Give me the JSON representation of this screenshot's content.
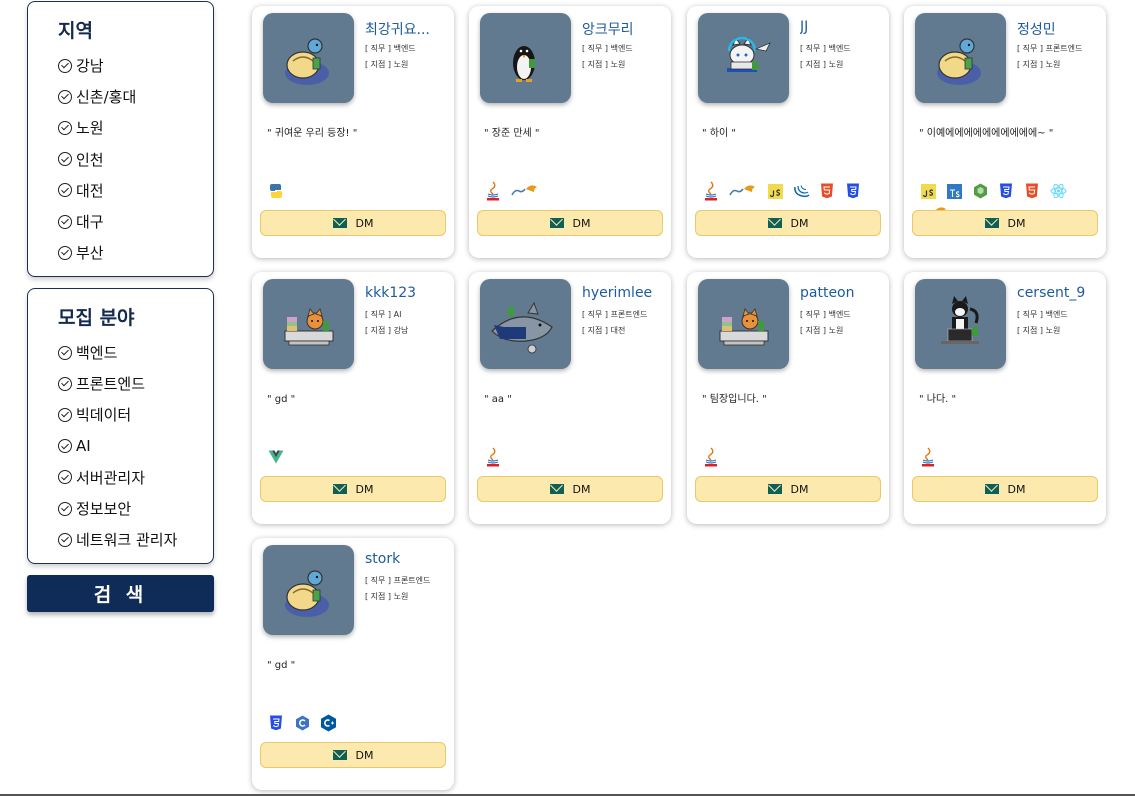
{
  "filters": {
    "region": {
      "title": "지역",
      "items": [
        "강남",
        "신촌/홍대",
        "노원",
        "인천",
        "대전",
        "대구",
        "부산"
      ]
    },
    "field": {
      "title": "모집 분야",
      "items": [
        "백엔드",
        "프론트엔드",
        "빅데이터",
        "AI",
        "서버관리자",
        "정보보안",
        "네트워크 관리자"
      ]
    },
    "search_label": "검 색"
  },
  "dm_label": "DM",
  "cards": [
    {
      "name": "최강귀요...",
      "job": "[ 직무 ] 백엔드",
      "branch": "[ 지점 ] 노원",
      "intro": "\" 귀여운 우리 등장! \"",
      "avatar": "turtle-avatar",
      "skills": [
        "python-icon"
      ]
    },
    {
      "name": "앙크무리",
      "job": "[ 직무 ] 백엔드",
      "branch": "[ 지점 ] 노원",
      "intro": "\" 장준 만세 \"",
      "avatar": "penguin-avatar",
      "skills": [
        "java-icon",
        "mysql-icon"
      ]
    },
    {
      "name": "JJ",
      "job": "[ 직무 ] 백엔드",
      "branch": "[ 지점 ] 노원",
      "intro": "\" 하이 \"",
      "avatar": "cat-laptop-avatar",
      "skills": [
        "java-icon",
        "mysql-icon",
        "javascript-icon",
        "jquery-icon",
        "html5-icon",
        "css3-icon"
      ]
    },
    {
      "name": "정성민",
      "job": "[ 직무 ] 프론트엔드",
      "branch": "[ 지점 ] 노원",
      "intro": "\" 이예에에에에에에에에에에~ \"",
      "avatar": "turtle-avatar",
      "skills": [
        "javascript-icon",
        "typescript-icon",
        "nodejs-icon",
        "css3-icon",
        "html5-icon",
        "react-icon",
        "mysql-icon"
      ]
    },
    {
      "name": "kkk123",
      "job": "[ 직무 ] AI",
      "branch": "[ 지점 ] 강남",
      "intro": "\" gd \"",
      "avatar": "cat-desk-avatar",
      "skills": [
        "vue-icon"
      ]
    },
    {
      "name": "hyerimlee",
      "job": "[ 직무 ] 프론트엔드",
      "branch": "[ 지점 ] 대전",
      "intro": "\" aa \"",
      "avatar": "shark-avatar",
      "skills": [
        "java-icon"
      ]
    },
    {
      "name": "patteon",
      "job": "[ 직무 ] 백엔드",
      "branch": "[ 지점 ] 노원",
      "intro": "\" 팀장입니다. \"",
      "avatar": "cat-desk-avatar",
      "skills": [
        "java-icon"
      ]
    },
    {
      "name": "cersent_9",
      "job": "[ 직무 ] 백엔드",
      "branch": "[ 지점 ] 노원",
      "intro": "\" 나다. \"",
      "avatar": "tuxedo-cat-avatar",
      "skills": [
        "java-icon"
      ]
    },
    {
      "name": "stork",
      "job": "[ 직무 ] 프론트엔드",
      "branch": "[ 지점 ] 노원",
      "intro": "\" gd \"",
      "avatar": "turtle-avatar",
      "skills": [
        "css3-icon",
        "c-icon",
        "cplusplus-icon"
      ]
    }
  ],
  "colors": {
    "navy": "#0f2b57",
    "accent_name": "#1d5a9e",
    "avatar_bg": "#617a90",
    "dm_bg": "#fbe9ad",
    "dm_icon": "#0e5f56"
  }
}
